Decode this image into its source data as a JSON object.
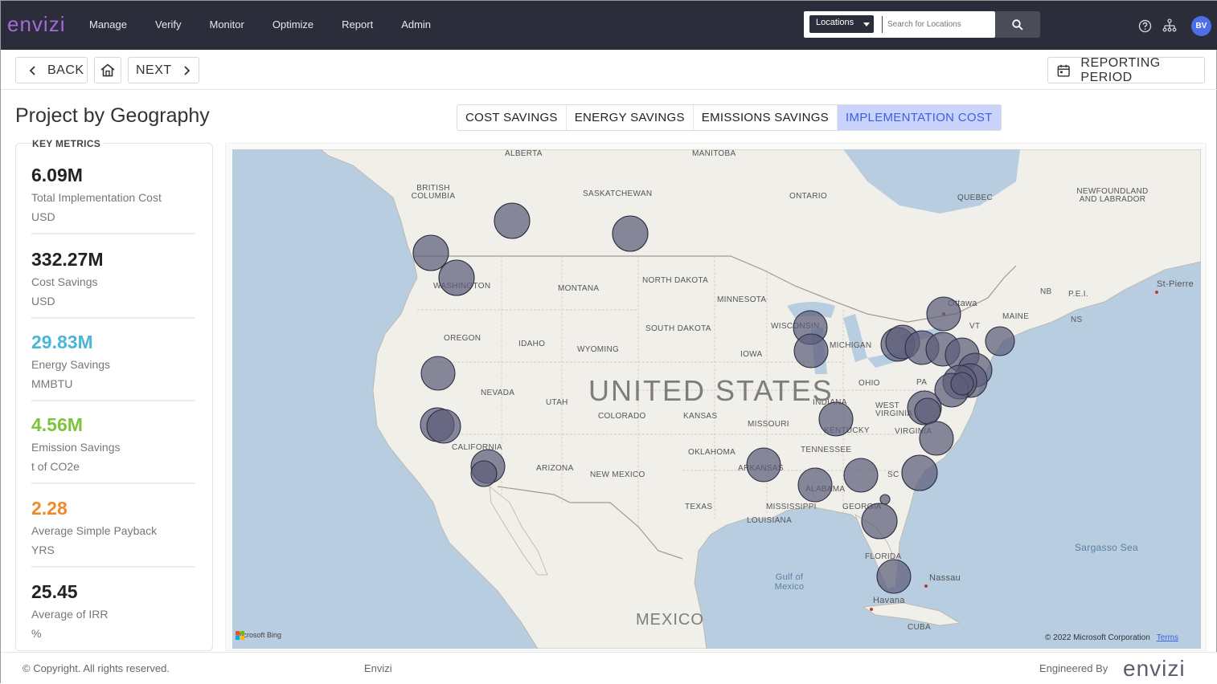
{
  "app": {
    "logo": "envizi",
    "nav": [
      "Manage",
      "Verify",
      "Monitor",
      "Optimize",
      "Report",
      "Admin"
    ],
    "location_select": "Locations",
    "search_placeholder": "Search for Locations",
    "avatar_initials": "BV"
  },
  "toolbar": {
    "back_label": "BACK",
    "next_label": "NEXT",
    "reporting_label": "REPORTING PERIOD"
  },
  "page": {
    "title": "Project by Geography",
    "tabs": [
      {
        "label": "COST SAVINGS",
        "active": false
      },
      {
        "label": "ENERGY SAVINGS",
        "active": false
      },
      {
        "label": "EMISSIONS SAVINGS",
        "active": false
      },
      {
        "label": "IMPLEMENTATION COST",
        "active": true
      }
    ]
  },
  "metrics": {
    "heading": "KEY METRICS",
    "items": [
      {
        "value": "6.09M",
        "label": "Total Implementation Cost",
        "unit": "USD",
        "color": "#222222"
      },
      {
        "value": "332.27M",
        "label": "Cost Savings",
        "unit": "USD",
        "color": "#222222"
      },
      {
        "value": "29.83M",
        "label": "Energy Savings",
        "unit": "MMBTU",
        "color": "#4ab6d8"
      },
      {
        "value": "4.56M",
        "label": "Emission Savings",
        "unit": "t of CO2e",
        "color": "#7cc43a"
      },
      {
        "value": "2.28",
        "label": "Average Simple Payback",
        "unit": "YRS",
        "color": "#f08a24"
      },
      {
        "value": "25.45",
        "label": "Average of IRR",
        "unit": "%",
        "color": "#222222"
      }
    ]
  },
  "map": {
    "country_label": "UNITED STATES",
    "mexico_label": "MEXICO",
    "labels": [
      "ALBERTA",
      "MANITOBA",
      "BRITISH COLUMBIA",
      "SASKATCHEWAN",
      "ONTARIO",
      "QUEBEC",
      "NEWFOUNDLAND AND LABRADOR",
      "MONTANA",
      "NORTH DAKOTA",
      "MINNESOTA",
      "WASHINGTON",
      "OREGON",
      "IDAHO",
      "WYOMING",
      "SOUTH DAKOTA",
      "WISCONSIN",
      "MICHIGAN",
      "IOWA",
      "NEVADA",
      "UTAH",
      "COLORADO",
      "KANSAS",
      "MISSOURI",
      "OHIO",
      "INDIANA",
      "KENTUCKY",
      "WEST VIRGINIA",
      "VIRGINIA",
      "PA",
      "CALIFORNIA",
      "ARIZONA",
      "NEW MEXICO",
      "OKLAHOMA",
      "ARKANSAS",
      "TENNESSEE",
      "TEXAS",
      "LOUISIANA",
      "MISSISSIPPI",
      "ALABAMA",
      "GEORGIA",
      "SC",
      "FLORIDA",
      "NB",
      "P.E.I.",
      "MAINE",
      "NS",
      "VT",
      "Ottawa",
      "St-Pierre",
      "Sargasso Sea",
      "Gulf of Mexico",
      "Nassau",
      "Havana",
      "CUBA"
    ],
    "attribution": "Microsoft Bing",
    "copyright": "© 2022 Microsoft Corporation",
    "terms": "Terms"
  },
  "footer": {
    "copyright": "© Copyright. All rights reserved.",
    "app_name": "Envizi",
    "engineered_by": "Engineered By",
    "logo": "envizi"
  }
}
